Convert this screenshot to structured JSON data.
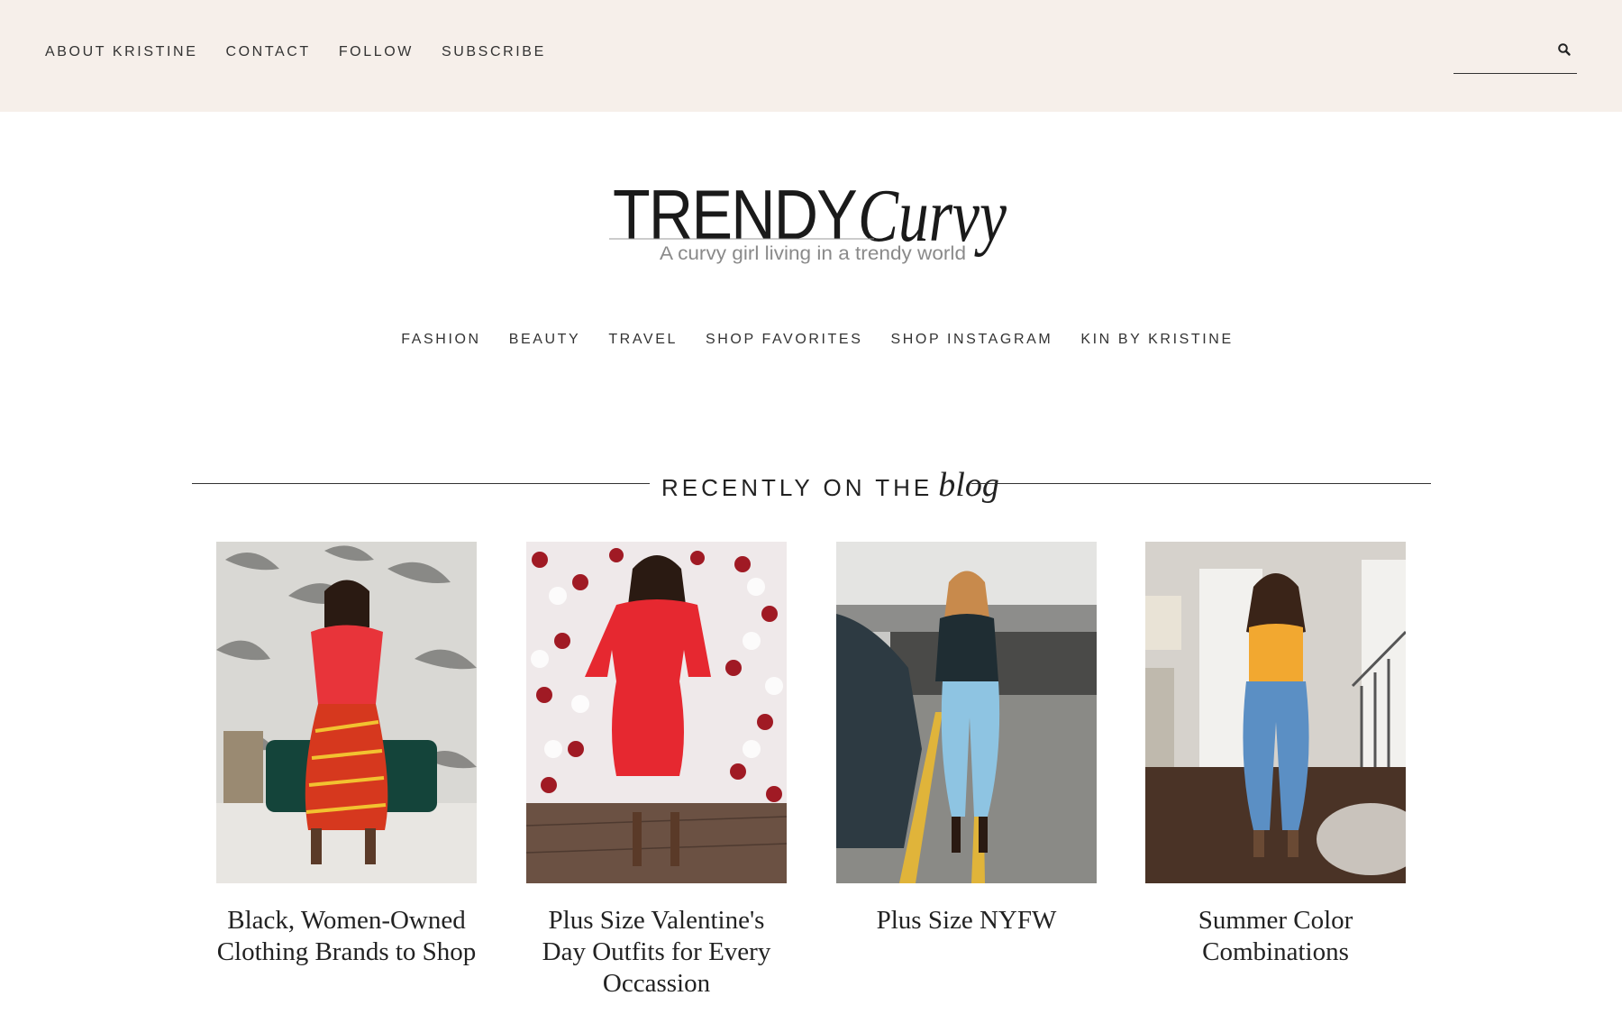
{
  "top_nav": {
    "items": [
      {
        "label": "ABOUT KRISTINE"
      },
      {
        "label": "CONTACT"
      },
      {
        "label": "FOLLOW"
      },
      {
        "label": "SUBSCRIBE"
      }
    ],
    "search": {
      "value": "",
      "placeholder": "",
      "icon": "search-icon"
    }
  },
  "logo": {
    "main": "TRENDY",
    "script": "Curvy",
    "tagline": "A curvy girl living in a trendy world"
  },
  "main_nav": {
    "items": [
      {
        "label": "FASHION"
      },
      {
        "label": "BEAUTY"
      },
      {
        "label": "TRAVEL"
      },
      {
        "label": "SHOP FAVORITES"
      },
      {
        "label": "SHOP INSTAGRAM"
      },
      {
        "label": "KIN BY KRISTINE"
      }
    ]
  },
  "section": {
    "title_caps": "RECENTLY ON THE",
    "title_script": "blog"
  },
  "posts": [
    {
      "title": "Black, Women-Owned Clothing Brands to Shop"
    },
    {
      "title": "Plus Size Valentine's Day Outfits for Every Occassion"
    },
    {
      "title": "Plus Size NYFW"
    },
    {
      "title": "Summer Color Combinations"
    }
  ],
  "colors": {
    "topbar_bg": "#f6efea",
    "text": "#2b2b2b",
    "accent_red": "#e8242b"
  }
}
